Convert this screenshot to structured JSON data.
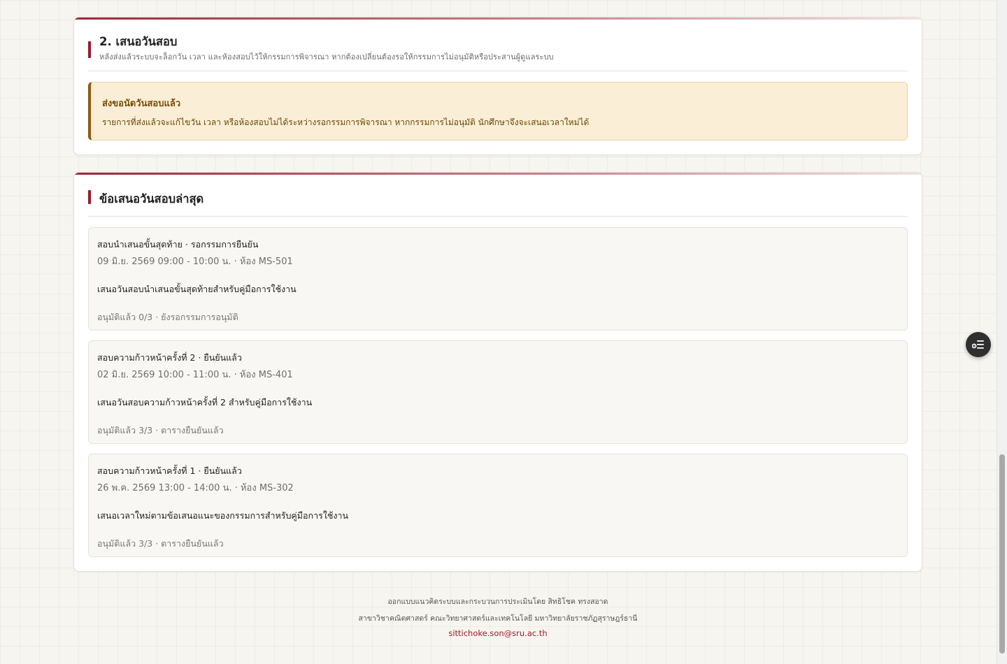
{
  "proposal_section": {
    "title": "2. เสนอวันสอบ",
    "subtitle": "หลังส่งแล้วระบบจะล็อกวัน เวลา และห้องสอบไว้ให้กรรมการพิจารณา หากต้องเปลี่ยนต้องรอให้กรรมการไม่อนุมัติหรือประสานผู้ดูแลระบบ",
    "notice": {
      "title": "ส่งขอนัดวันสอบแล้ว",
      "text": "รายการที่ส่งแล้วจะแก้ไขวัน เวลา หรือห้องสอบไม่ได้ระหว่างรอกรรมการพิจารณา หากกรรมการไม่อนุมัติ นักศึกษาจึงจะเสนอเวลาใหม่ได้"
    }
  },
  "latest_section": {
    "title": "ข้อเสนอวันสอบล่าสุด",
    "items": [
      {
        "title": "สอบนำเสนอขั้นสุดท้าย · รอกรรมการยืนยัน",
        "meta": "09 มิ.ย. 2569 09:00 - 10:00 น. · ห้อง MS-501",
        "description": "เสนอวันสอบนำเสนอขั้นสุดท้ายสำหรับคู่มือการใช้งาน",
        "status": "อนุมัติแล้ว 0/3 · ยังรอกรรมการอนุมัติ"
      },
      {
        "title": "สอบความก้าวหน้าครั้งที่ 2 · ยืนยันแล้ว",
        "meta": "02 มิ.ย. 2569 10:00 - 11:00 น. · ห้อง MS-401",
        "description": "เสนอวันสอบความก้าวหน้าครั้งที่ 2 สำหรับคู่มือการใช้งาน",
        "status": "อนุมัติแล้ว 3/3 · ตารางยืนยันแล้ว"
      },
      {
        "title": "สอบความก้าวหน้าครั้งที่ 1 · ยืนยันแล้ว",
        "meta": "26 พ.ค. 2569 13:00 - 14:00 น. · ห้อง MS-302",
        "description": "เสนอเวลาใหม่ตามข้อเสนอแนะของกรรมการสำหรับคู่มือการใช้งาน",
        "status": "อนุมัติแล้ว 3/3 · ตารางยืนยันแล้ว"
      }
    ]
  },
  "footer": {
    "line1": "ออกแบบแนวคิดระบบและกระบวนการประเมินโดย สิทธิโชค ทรงสอาด",
    "line2": "สาขาวิชาคณิตศาสตร์ คณะวิทยาศาสตร์และเทคโนโลยี มหาวิทยาลัยราชภัฏสุราษฎร์ธานี",
    "email": "sittichoke.son@sru.ac.th"
  },
  "floating_button": {
    "icon": "settings-list-icon"
  },
  "colors": {
    "accent": "#9b1b30",
    "notice_bg": "#faefd6",
    "notice_border": "#8a5a0e",
    "page_bg": "#f7f5f0"
  }
}
